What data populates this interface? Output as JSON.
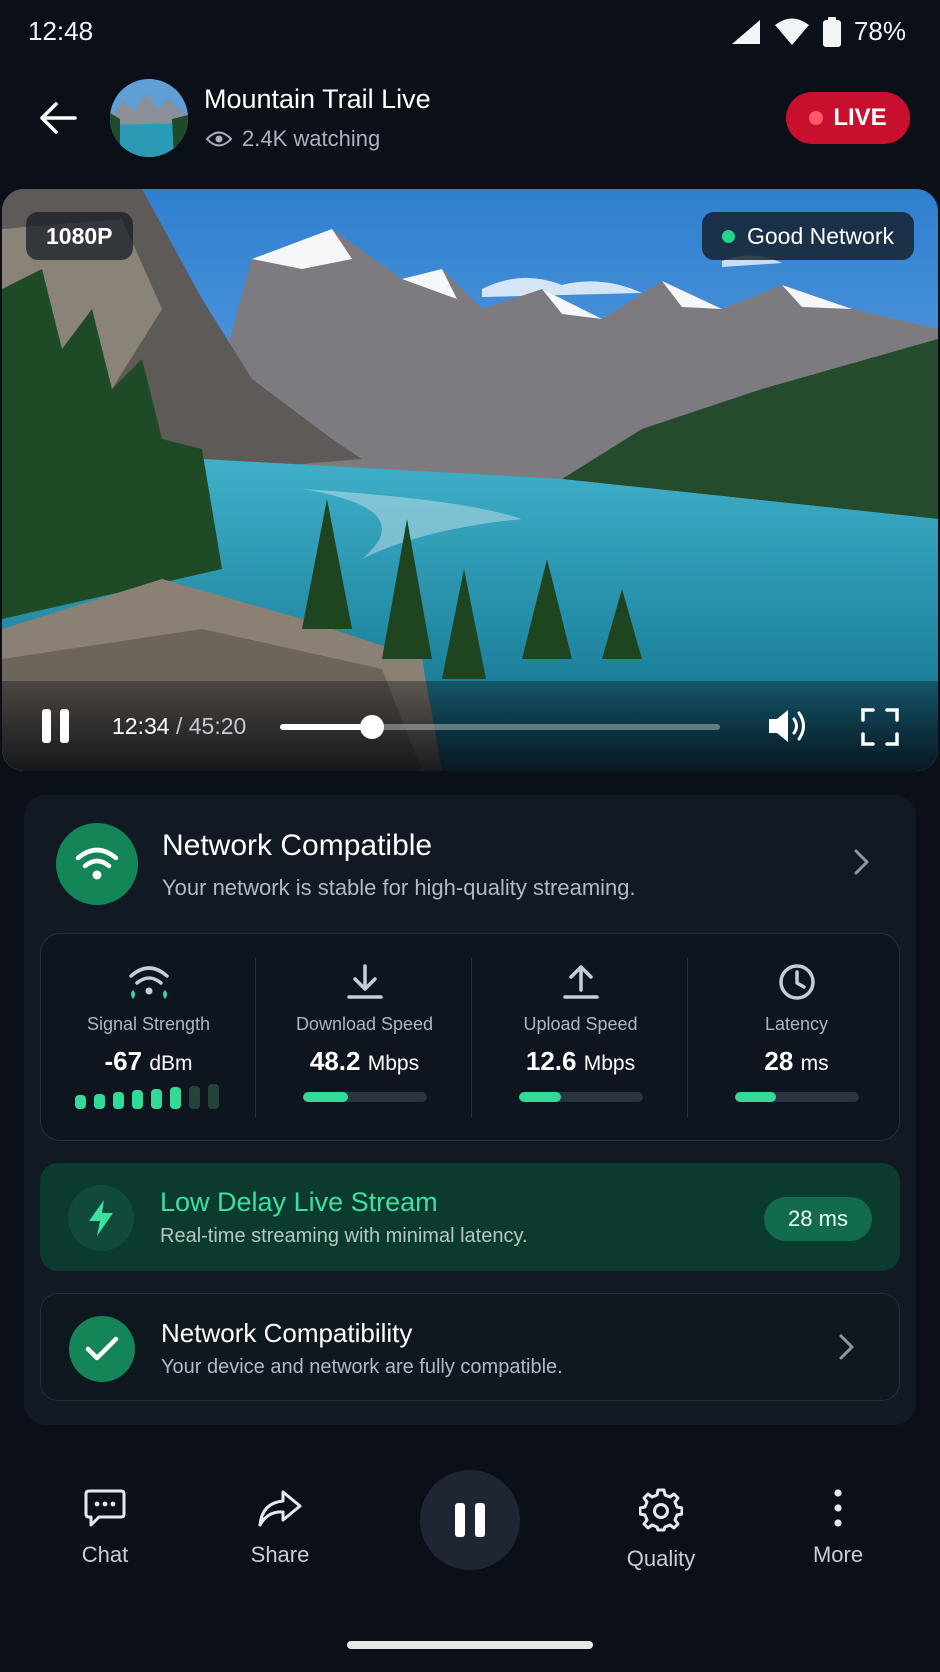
{
  "status_bar": {
    "time": "12:48",
    "battery_percent": "78%",
    "icons": [
      "cell-signal-icon",
      "wifi-icon",
      "battery-icon"
    ]
  },
  "header": {
    "title": "Mountain Trail Live",
    "watching": "2.4K watching",
    "live_label": "LIVE",
    "icons": [
      "back-arrow-icon",
      "eye-icon"
    ]
  },
  "video": {
    "quality": "1080P",
    "network_status": "Good Network",
    "current_time": "12:34",
    "separator": "/",
    "duration": "45:20",
    "progress": 0.21,
    "icons": [
      "pause-icon",
      "volume-icon",
      "fullscreen-icon"
    ]
  },
  "network_card": {
    "title": "Network Compatible",
    "subtitle": "Your network is stable for high-quality streaming.",
    "metrics": [
      {
        "label": "Signal Strength",
        "value": "-67",
        "unit": "dBm",
        "signal_level": 6,
        "signal_total": 8,
        "icon": "wifi-signal-icon"
      },
      {
        "label": "Download Speed",
        "value": "48.2",
        "unit": "Mbps",
        "fill": 0.36,
        "icon": "download-icon"
      },
      {
        "label": "Upload Speed",
        "value": "12.6",
        "unit": "Mbps",
        "fill": 0.34,
        "icon": "upload-icon"
      },
      {
        "label": "Latency",
        "value": "28",
        "unit": "ms",
        "fill": 0.33,
        "icon": "clock-icon"
      }
    ]
  },
  "low_delay": {
    "title": "Low Delay Live Stream",
    "subtitle": "Real-time streaming with minimal latency.",
    "badge": "28 ms",
    "icon": "lightning-icon"
  },
  "compatibility": {
    "title": "Network Compatibility",
    "subtitle": "Your device and network are fully compatible.",
    "icon": "check-icon"
  },
  "bottom_nav": {
    "items": [
      {
        "label": "Chat",
        "icon": "chat-icon"
      },
      {
        "label": "Share",
        "icon": "share-icon"
      },
      {
        "label": "Quality",
        "icon": "gear-icon"
      },
      {
        "label": "More",
        "icon": "more-vertical-icon"
      }
    ],
    "center": "pause-icon"
  },
  "colors": {
    "background": "#0b1018",
    "card": "#111923",
    "accent_green": "#33d996",
    "live_red": "#c8102e",
    "low_delay_bg": "#0b3b2e"
  }
}
